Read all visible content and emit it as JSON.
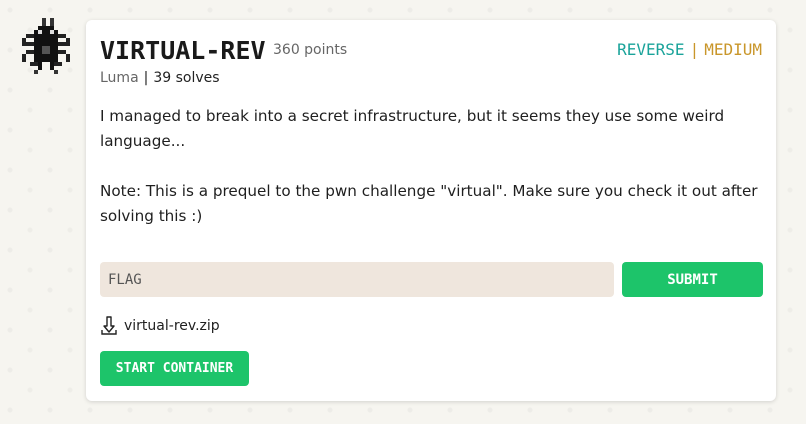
{
  "author_avatar": {
    "icon": "pixel-spider-icon"
  },
  "challenge": {
    "title": "VIRTUAL-REV",
    "points": "360 points",
    "category": "REVERSE",
    "tag_separator": "|",
    "difficulty": "MEDIUM",
    "author": "Luma",
    "meta_separator": "|",
    "solves": "39 solves",
    "description": [
      "I managed to break into a secret infrastructure, but it seems they use some weird language...",
      "Note: This is a prequel to the pwn challenge \"virtual\". Make sure you check it out after solving this :)"
    ]
  },
  "flag_form": {
    "placeholder": "FLAG",
    "submit_label": "SUBMIT"
  },
  "attachment": {
    "icon": "download-icon",
    "filename": "virtual-rev.zip"
  },
  "container": {
    "start_label": "START CONTAINER"
  },
  "colors": {
    "category": "#1aa39a",
    "difficulty": "#c9962a",
    "button": "#1dc46a",
    "input_bg": "#efe6dd"
  }
}
